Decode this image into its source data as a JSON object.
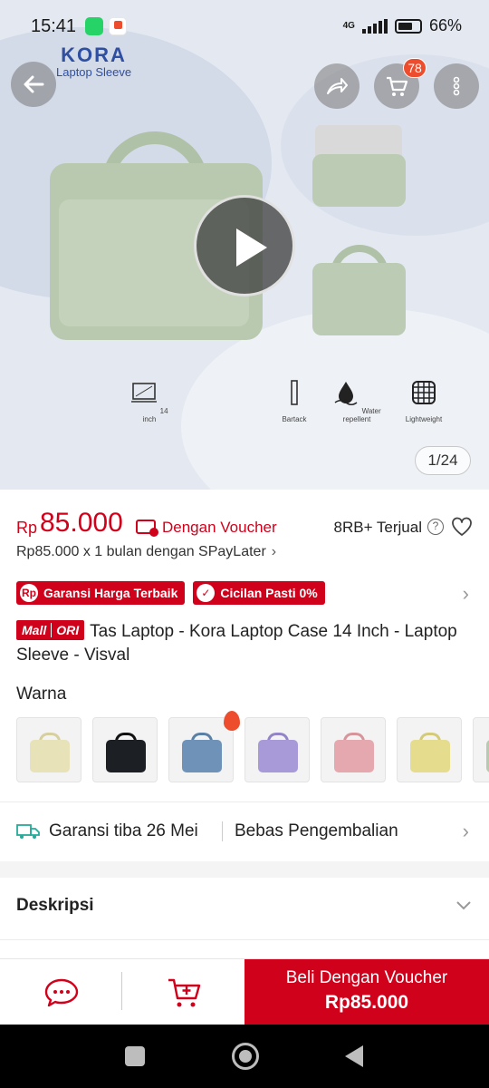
{
  "status_bar": {
    "time": "15:41",
    "network": "4G",
    "battery": "66%"
  },
  "hero": {
    "brand_name": "KORA",
    "brand_sub": "Laptop Sleeve",
    "cart_count": "78",
    "image_counter": "1/24",
    "features": [
      {
        "icon": "laptop-size-icon",
        "label": "14 inch"
      },
      {
        "icon": "bartack-icon",
        "label": "Bartack"
      },
      {
        "icon": "water-drop-icon",
        "label": "Water repellent"
      },
      {
        "icon": "lightweight-icon",
        "label": "Lightweight"
      }
    ]
  },
  "price": {
    "currency": "Rp",
    "amount": "85.000",
    "voucher_text": "Dengan Voucher",
    "sold": "8RB+ Terjual",
    "help": "?",
    "paylater": "Rp85.000 x 1 bulan dengan SPayLater",
    "paylater_chevron": "›"
  },
  "badges": [
    {
      "icon": "Rp",
      "label": "Garansi Harga Terbaik"
    },
    {
      "icon": "✓",
      "label": "Cicilan Pasti 0%"
    }
  ],
  "product": {
    "mall_tag": "Mall",
    "ori_tag": "ORI",
    "title": "Tas Laptop - Kora Laptop Case 14 Inch - Laptop Sleeve - Visval"
  },
  "variants": {
    "label": "Warna",
    "swatches": [
      {
        "name": "cream",
        "color": "#e8e2b8"
      },
      {
        "name": "black",
        "color": "#1c1f24"
      },
      {
        "name": "blue",
        "color": "#6f93b8"
      },
      {
        "name": "purple",
        "color": "#a89ad8"
      },
      {
        "name": "pink",
        "color": "#e5a8ae"
      },
      {
        "name": "yellow",
        "color": "#e6dc8e"
      },
      {
        "name": "green",
        "color": "#b9c9b0"
      }
    ]
  },
  "shipping": {
    "arrival": "Garansi tiba 26 Mei",
    "returns": "Bebas Pengembalian"
  },
  "description": {
    "label": "Deskripsi"
  },
  "bottom_bar": {
    "buy_label": "Beli Dengan Voucher",
    "buy_price": "Rp85.000"
  },
  "colors": {
    "accent": "#d0011b",
    "orange": "#ee4d2d"
  }
}
